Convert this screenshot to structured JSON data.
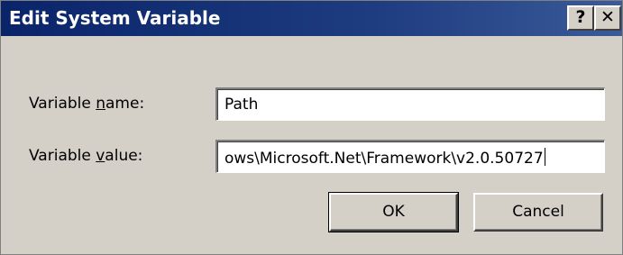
{
  "window": {
    "title": "Edit System Variable",
    "help_button": "?",
    "close_button": "✕"
  },
  "form": {
    "variable_name_label_pre": "Variable ",
    "variable_name_label_accel": "n",
    "variable_name_label_post": "ame:",
    "variable_name_value": "Path",
    "variable_value_label_pre": "Variable ",
    "variable_value_label_accel": "v",
    "variable_value_label_post": "alue:",
    "variable_value_value": "ows\\Microsoft.Net\\Framework\\v2.0.50727"
  },
  "buttons": {
    "ok_label": "OK",
    "cancel_label": "Cancel"
  },
  "colors": {
    "titlebar": "#0a246a",
    "face": "#d4d0c8"
  }
}
